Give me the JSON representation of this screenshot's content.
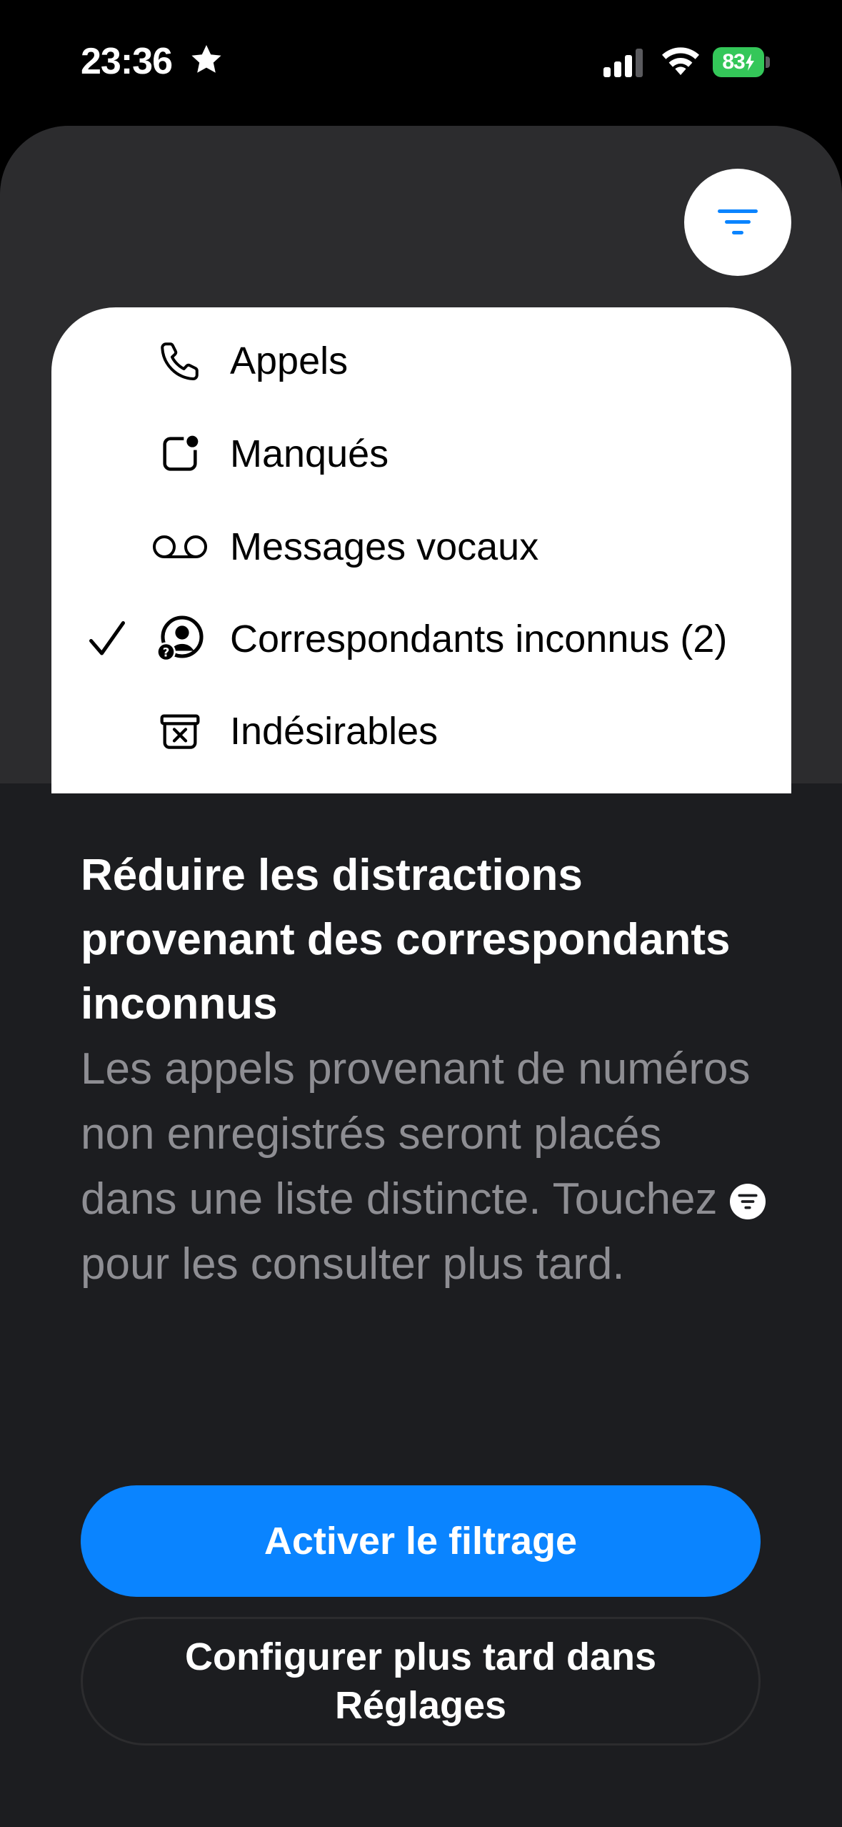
{
  "status_bar": {
    "time": "23:36",
    "battery_level": "83",
    "icons": [
      "star-icon",
      "cellular-signal-icon",
      "wifi-icon",
      "battery-charging-icon"
    ]
  },
  "filter_button": {
    "icon": "filter-lines-icon",
    "color": "#0a84ff"
  },
  "menu": {
    "items": [
      {
        "label": "Appels",
        "icon": "phone-icon",
        "checked": false
      },
      {
        "label": "Manqués",
        "icon": "missed-badge-icon",
        "checked": false
      },
      {
        "label": "Messages vocaux",
        "icon": "voicemail-icon",
        "checked": false
      },
      {
        "label": "Correspondants inconnus (2)",
        "icon": "unknown-caller-icon",
        "checked": true
      },
      {
        "label": "Indésirables",
        "icon": "junk-bin-icon",
        "checked": false
      }
    ]
  },
  "content": {
    "headline": "Réduire les distractions provenant des correspondants inconnus",
    "body_before_icon": "Les appels provenant de numéros non enregistrés seront placés dans une liste distincte. Touchez ",
    "body_after_icon": " pour les consulter plus tard.",
    "inline_icon": "filter-circle-icon"
  },
  "buttons": {
    "primary": "Activer le filtrage",
    "secondary": "Configurer plus tard dans Réglages"
  },
  "colors": {
    "accent": "#0a84ff",
    "battery": "#34c759",
    "background": "#1c1d20",
    "secondary_text": "#8e8e93"
  }
}
